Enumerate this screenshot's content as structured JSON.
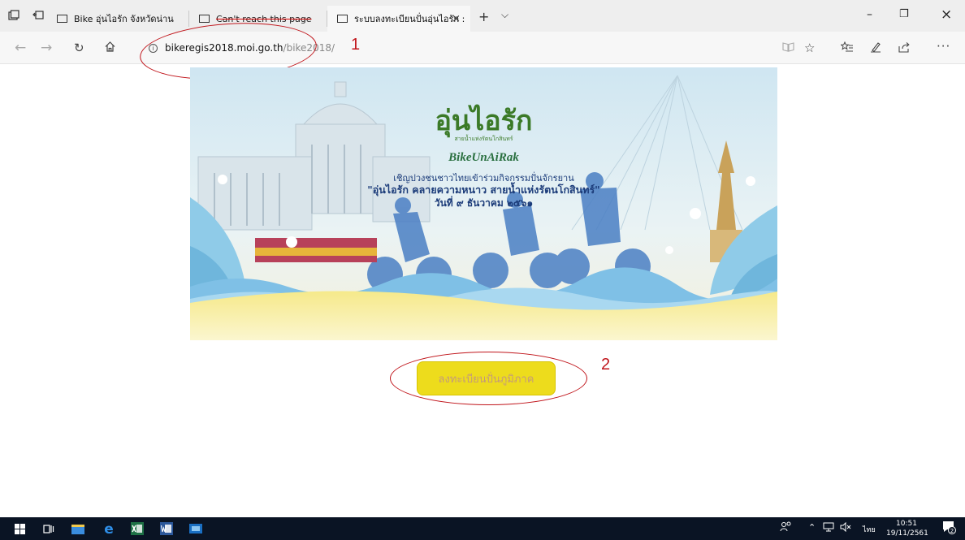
{
  "browser": {
    "tabs": [
      {
        "label": "Bike อุ่นไอรัก จังหวัดน่าน",
        "active": false,
        "unreachable": false
      },
      {
        "label": "Can't reach this page",
        "active": false,
        "unreachable": true
      },
      {
        "label": "ระบบลงทะเบียนปั่นอุ่นไอรัก :",
        "active": true,
        "unreachable": false
      }
    ],
    "new_tab_symbol": "+",
    "tab_dropdown_symbol": "⌵",
    "close_symbol": "×",
    "window_controls": {
      "minimize": "–",
      "maximize": "❐",
      "close": "×"
    },
    "address": {
      "host": "bikeregis2018.moi.go.th",
      "path": "/bike2018/"
    },
    "icons": [
      "back-icon",
      "forward-icon",
      "refresh-icon",
      "home-icon",
      "info-icon",
      "reading-view-icon",
      "favorite-star-icon",
      "favorites-hub-icon",
      "pen-icon",
      "share-icon",
      "more-icon"
    ]
  },
  "annotations": {
    "marker1": "1",
    "marker2": "2",
    "color": "#c0141a"
  },
  "banner": {
    "logo_title": "อุ่นไอรัก",
    "logo_subtitle": "สายน้ำแห่งรัตนโกสินทร์",
    "logo_en": "BikeUnAiRak",
    "invite_line1": "เชิญปวงชนชาวไทยเข้าร่วมกิจกรรมปั่นจักรยาน",
    "invite_line2": "\"อุ่นไอรัก คลายความหนาว สายน้ำแห่งรัตนโกสินทร์\"",
    "invite_line3": "วันที่ ๙ ธันวาคม ๒๕๖๑"
  },
  "register_button": {
    "label": "ลงทะเบียนปั่นภูมิภาค",
    "color": "#eddc1c"
  },
  "taskbar": {
    "icons": [
      "windows-start-icon",
      "task-view-icon",
      "file-explorer-icon",
      "edge-icon",
      "excel-icon",
      "word-icon",
      "photos-icon"
    ],
    "tray_language": "ไทย",
    "clock_time": "10:51",
    "clock_date": "19/11/2561",
    "notification_count": "2"
  }
}
